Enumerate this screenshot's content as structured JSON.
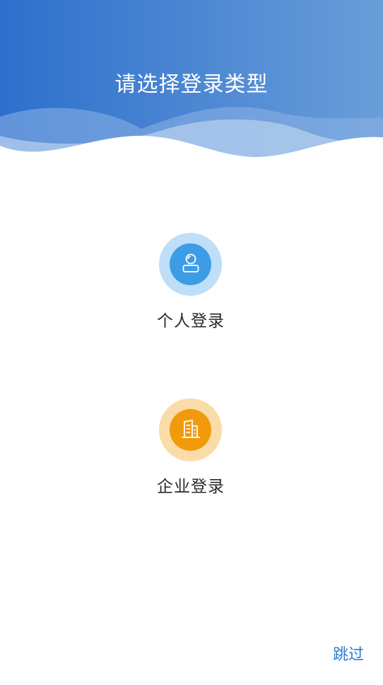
{
  "header": {
    "title": "请选择登录类型"
  },
  "options": [
    {
      "label": "个人登录",
      "icon": "user-icon",
      "color": "#3d9ce6"
    },
    {
      "label": "企业登录",
      "icon": "building-icon",
      "color": "#f29a0c"
    }
  ],
  "footer": {
    "skip_label": "跳过"
  },
  "colors": {
    "header_gradient_start": "#2d6fcc",
    "header_gradient_end": "#6a9ed9",
    "accent": "#2f7ad3"
  }
}
